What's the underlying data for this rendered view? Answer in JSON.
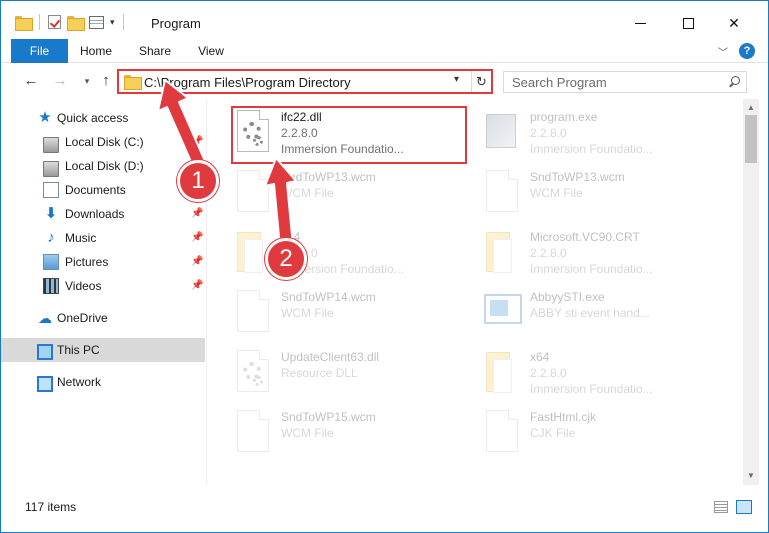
{
  "window": {
    "title": "Program"
  },
  "ribbon": {
    "tabs": [
      "File",
      "Home",
      "Share",
      "View"
    ],
    "help_label": "?"
  },
  "address": {
    "path": "C:\\Program Files\\Program Directory"
  },
  "search": {
    "placeholder": "Search Program"
  },
  "sidebar": {
    "items": [
      {
        "label": "Quick access",
        "icon": "star-icon",
        "pinned": false
      },
      {
        "label": "Local Disk (C:)",
        "icon": "disk-icon",
        "pinned": true
      },
      {
        "label": "Local Disk (D:)",
        "icon": "disk-icon",
        "pinned": false
      },
      {
        "label": "Documents",
        "icon": "documents-icon",
        "pinned": true
      },
      {
        "label": "Downloads",
        "icon": "downloads-icon",
        "pinned": true
      },
      {
        "label": "Music",
        "icon": "music-icon",
        "pinned": true
      },
      {
        "label": "Pictures",
        "icon": "pictures-icon",
        "pinned": true
      },
      {
        "label": "Videos",
        "icon": "videos-icon",
        "pinned": true
      },
      {
        "label": "OneDrive",
        "icon": "onedrive-icon",
        "pinned": false
      },
      {
        "label": "This PC",
        "icon": "this-pc-icon",
        "pinned": false,
        "selected": true
      },
      {
        "label": "Network",
        "icon": "network-icon",
        "pinned": false
      }
    ]
  },
  "files": [
    {
      "name": "ifc22.dll",
      "line2": "2.2.8.0",
      "line3": "Immersion Foundatio...",
      "icon": "dll-gear-icon",
      "highlighted": true
    },
    {
      "name": "program.exe",
      "line2": "2.2.8.0",
      "line3": "Immersion Foundatio...",
      "icon": "exe-icon",
      "highlighted": false
    },
    {
      "name": "SndToWP13.wcm",
      "line2": "WCM File",
      "line3": "",
      "icon": "document-icon",
      "highlighted": false
    },
    {
      "name": "SndToWP13.wcm",
      "line2": "WCM File",
      "line3": "",
      "icon": "document-icon",
      "highlighted": false
    },
    {
      "name": "x64",
      "line2": "2.2.8.0",
      "line3": "Immersion Foundatio...",
      "icon": "folder-icon",
      "highlighted": false
    },
    {
      "name": "Microsoft.VC90.CRT",
      "line2": "2.2.8.0",
      "line3": "Immersion Foundatio...",
      "icon": "folder-icon",
      "highlighted": false
    },
    {
      "name": "SndToWP14.wcm",
      "line2": "WCM File",
      "line3": "",
      "icon": "document-icon",
      "highlighted": false
    },
    {
      "name": "AbbyySTI.exe",
      "line2": "ABBY sti event hand...",
      "line3": "",
      "icon": "app-icon",
      "highlighted": false
    },
    {
      "name": "UpdateClient63.dll",
      "line2": "Resource DLL",
      "line3": "",
      "icon": "dll-gear-icon",
      "highlighted": false
    },
    {
      "name": "x64",
      "line2": "2.2.8.0",
      "line3": "Immersion Foundatio...",
      "icon": "folder-icon",
      "highlighted": false
    },
    {
      "name": "SndToWP15.wcm",
      "line2": "WCM File",
      "line3": "",
      "icon": "document-icon",
      "highlighted": false
    },
    {
      "name": "FastHtml.cjk",
      "line2": "CJK File",
      "line3": "",
      "icon": "document-icon",
      "highlighted": false
    }
  ],
  "status": {
    "item_count": "117 items"
  },
  "callouts": {
    "badge_1": "1",
    "badge_2": "2",
    "color": "#e03a3e"
  },
  "colors": {
    "accent": "#1979ca",
    "highlight": "#e03a3e"
  }
}
